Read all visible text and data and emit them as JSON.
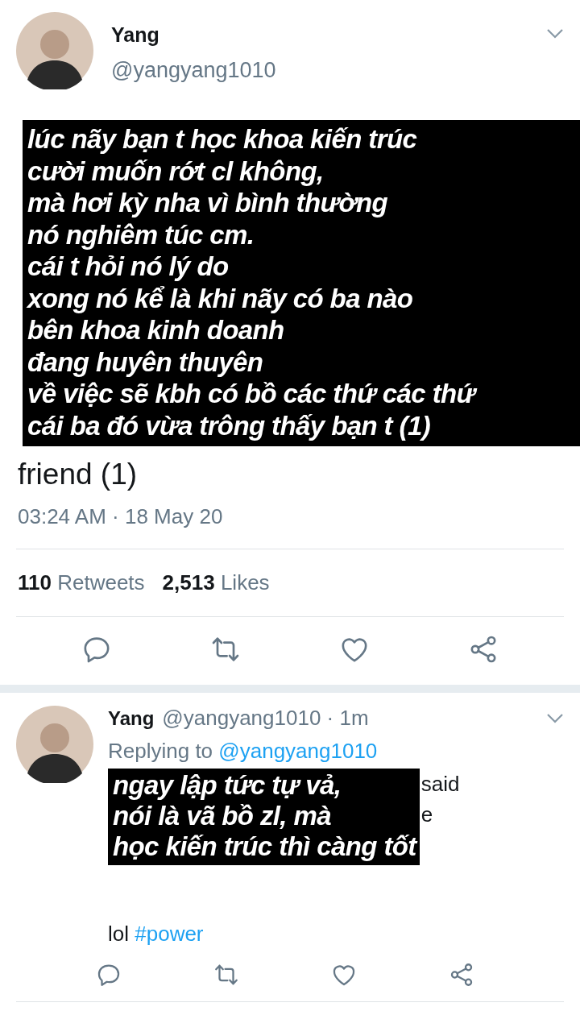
{
  "tweet": {
    "name": "Yang",
    "handle": "@yangyang1010",
    "caption": [
      "lúc nãy bạn t học khoa kiến trúc",
      "cười muốn rớt cl không,",
      "mà hơi kỳ nha vì bình thường",
      "nó nghiêm túc cm.",
      "cái t hỏi nó lý do",
      "xong nó kể là khi nãy có ba nào",
      "bên khoa kinh doanh",
      "đang huyên thuyên",
      "về việc sẽ kbh có bồ các thứ các thứ",
      "cái ba đó vừa trông thấy bạn t (1)"
    ],
    "text": "friend (1)",
    "timestamp": "03:24 AM · 18 May 20",
    "stats": [
      {
        "count": "110",
        "label": "Retweets"
      },
      {
        "count": "2,513",
        "label": "Likes"
      }
    ]
  },
  "reply": {
    "name": "Yang",
    "meta": "@yangyang1010 · 1m",
    "replying_to": "Replying to",
    "mention": "@yangyang1010",
    "caption": [
      "ngay lập tức tự vả,",
      "nói là vã bồ zl, mà",
      "học kiến trúc thì càng tốt"
    ],
    "fragments": [
      "said",
      "e"
    ],
    "text": "lol",
    "hashtag": "#power"
  }
}
